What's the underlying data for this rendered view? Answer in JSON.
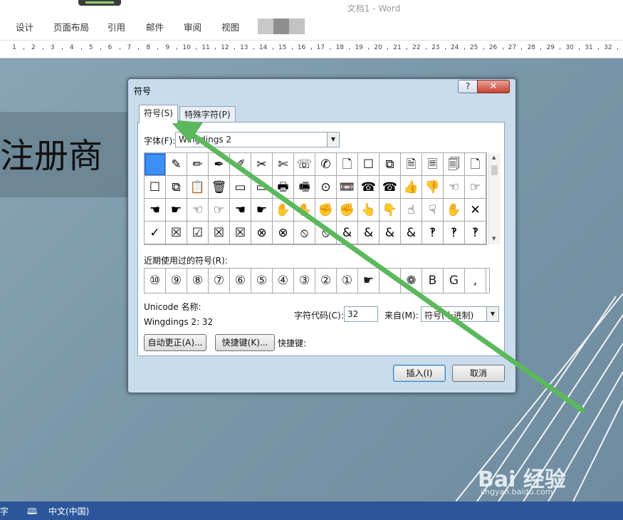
{
  "window": {
    "title": "文档1 - Word"
  },
  "ribbon": {
    "tabs": [
      "设计",
      "页面布局",
      "引用",
      "邮件",
      "审阅",
      "视图"
    ]
  },
  "ruler": {
    "numbers": [
      "1",
      "2",
      "3",
      "4",
      "5",
      "6",
      "7",
      "8",
      "9",
      "10",
      "11",
      "12",
      "13",
      "14",
      "15",
      "16",
      "17",
      "18",
      "19",
      "20",
      "21",
      "22",
      "23",
      "24",
      "25",
      "26",
      "27",
      "28",
      "29",
      "30",
      "31",
      "32"
    ]
  },
  "document": {
    "title_text": "注册商"
  },
  "dialog": {
    "title": "符号",
    "help_label": "?",
    "close_label": "✕",
    "tabs": {
      "symbols": "符号(S)",
      "special": "特殊字符(P)"
    },
    "font_label": "字体(F):",
    "font_value": "Wingdings 2",
    "symbol_grid": [
      [
        "",
        "✎",
        "✏",
        "✒",
        "✐",
        "✂",
        "✄",
        "☏",
        "✆",
        "🗋",
        "☐",
        "⧉",
        "🗎",
        "🗏",
        "🗐",
        "🗋"
      ],
      [
        "☐",
        "⧉",
        "📋",
        "🗑",
        "▭",
        "▭",
        "🖶",
        "🖷",
        "⊙",
        "📼",
        "☎",
        "☎",
        "👍",
        "👎",
        "☜",
        "☞"
      ],
      [
        "☚",
        "☛",
        "☜",
        "☞",
        "☚",
        "☛",
        "✋",
        "✋",
        "✊",
        "✊",
        "👆",
        "👇",
        "☝",
        "☟",
        "✋",
        "✕"
      ],
      [
        "✓",
        "☒",
        "☑",
        "☒",
        "☒",
        "⊗",
        "⊗",
        "⦸",
        "⦸",
        "&",
        "&",
        "&",
        "&",
        "‽",
        "‽",
        "‽"
      ]
    ],
    "recent_label": "近期使用过的符号(R):",
    "recent_symbols": [
      "⑩",
      "⑨",
      "⑧",
      "⑦",
      "⑥",
      "⑤",
      "④",
      "③",
      "②",
      "①",
      "☛",
      "",
      "❁",
      "B",
      "G",
      ","
    ],
    "unicode_name_label": "Unicode 名称:",
    "unicode_name_value": "Wingdings 2: 32",
    "char_code_label": "字符代码(C):",
    "char_code_value": "32",
    "from_label": "来自(M):",
    "from_value": "符号(十进制)",
    "autocorrect_label": "自动更正(A)...",
    "shortcut_key_button_label": "快捷键(K)...",
    "shortcut_key_text": "快捷键:",
    "insert_label": "插入(I)",
    "cancel_label": "取消"
  },
  "watermark": {
    "brand": "Bai 经验",
    "url": "jingyan.baidu.com"
  },
  "status_bar": {
    "word_count": "字",
    "language": "中文(中国)"
  },
  "annotation_color": "#5cb85c"
}
